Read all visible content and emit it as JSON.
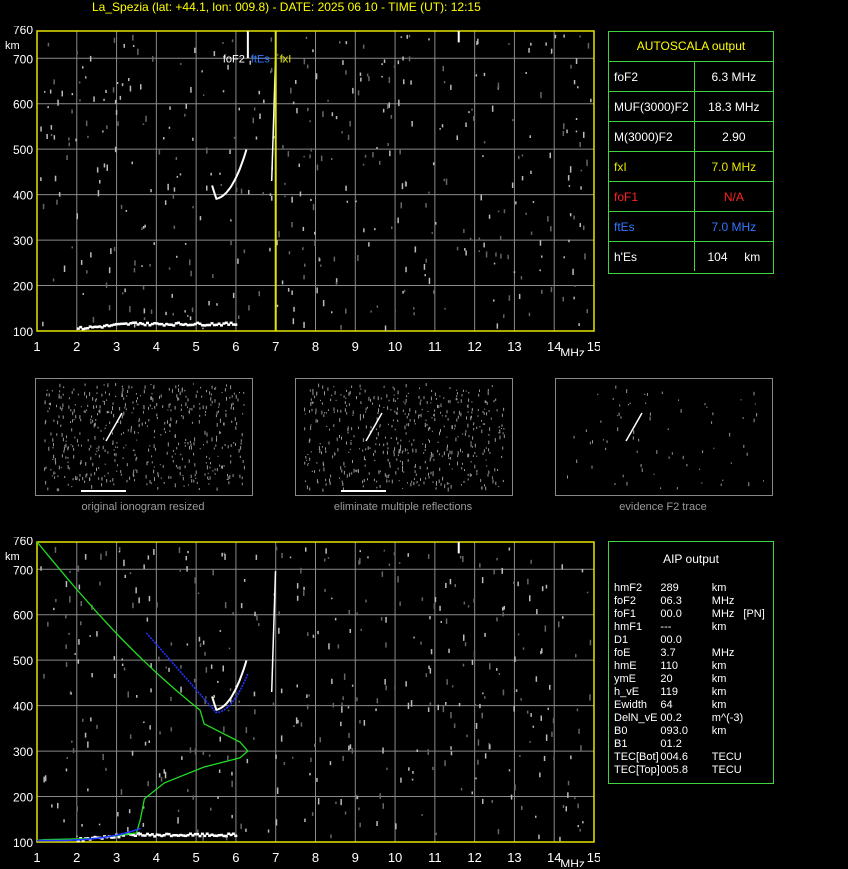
{
  "header": "La_Spezia (lat: +44.1, lon: 009.8) - DATE: 2025 06 10 - TIME (UT): 12:15",
  "colors": {
    "grid": "#8a8a8a",
    "frame": "#e6e600",
    "panel_border": "#3fd53f",
    "yellow": "#ffff00",
    "blue": "#3377ff",
    "red": "#ff2222",
    "green": "#22dd22",
    "aip_trace": "#2233ff"
  },
  "axes": {
    "x_ticks": [
      "1",
      "2",
      "3",
      "4",
      "5",
      "6",
      "7",
      "8",
      "9",
      "10",
      "11",
      "12",
      "13",
      "14",
      "15"
    ],
    "x_unit": "MHz",
    "y_ticks": [
      "100",
      "200",
      "300",
      "400",
      "500",
      "600",
      "700",
      "760"
    ],
    "y_unit": "km"
  },
  "top_plot": {
    "labels": {
      "foF2": "foF2",
      "ftEs": "ftEs",
      "fxI": "fxI"
    },
    "marker_freqs_mhz": {
      "foF2": 6.3,
      "fxI": 7.0
    }
  },
  "autoscala": {
    "title": "AUTOSCALA output",
    "rows": [
      {
        "label": "foF2",
        "value": "6.3 MHz",
        "color": "#ffffff"
      },
      {
        "label": "MUF(3000)F2",
        "value": "18.3 MHz",
        "color": "#ffffff"
      },
      {
        "label": "M(3000)F2",
        "value": "2.90",
        "color": "#ffffff"
      },
      {
        "label": "fxI",
        "value": "7.0 MHz",
        "color": "#e6e600"
      },
      {
        "label": "foF1",
        "value": "N/A",
        "color": "#ff2222"
      },
      {
        "label": "ftEs",
        "value": "7.0 MHz",
        "color": "#3377ff"
      },
      {
        "label": "h'Es",
        "value": "104     km",
        "color": "#ffffff"
      }
    ]
  },
  "thumbnails": [
    {
      "caption": "original ionogram resized"
    },
    {
      "caption": "eliminate multiple reflections"
    },
    {
      "caption": "evidence F2 trace"
    }
  ],
  "aip": {
    "title": "AIP output",
    "rows": [
      [
        "hmF2",
        "289",
        "km",
        ""
      ],
      [
        "foF2",
        "06.3",
        "MHz",
        ""
      ],
      [
        "foF1",
        "00.0",
        "MHz",
        "[PN]"
      ],
      [
        "hmF1",
        "---",
        "km",
        ""
      ],
      [
        "D1",
        "00.0",
        "",
        ""
      ],
      [
        "foE",
        "3.7",
        "MHz",
        ""
      ],
      [
        "hmE",
        "110",
        "km",
        ""
      ],
      [
        "ymE",
        "20",
        "km",
        ""
      ],
      [
        "h_vE",
        "119",
        "km",
        ""
      ],
      [
        "Ewidth",
        "64",
        "km",
        ""
      ],
      [
        "DelN_vE",
        "00.2",
        "m^(-3)",
        ""
      ],
      [
        "B0",
        "093.0",
        "km",
        ""
      ],
      [
        "B1",
        "01.2",
        "",
        ""
      ],
      [
        "TEC[Bot]",
        "004.6",
        "TECU",
        ""
      ],
      [
        "TEC[Top]",
        "005.8",
        "TECU",
        ""
      ]
    ]
  }
}
